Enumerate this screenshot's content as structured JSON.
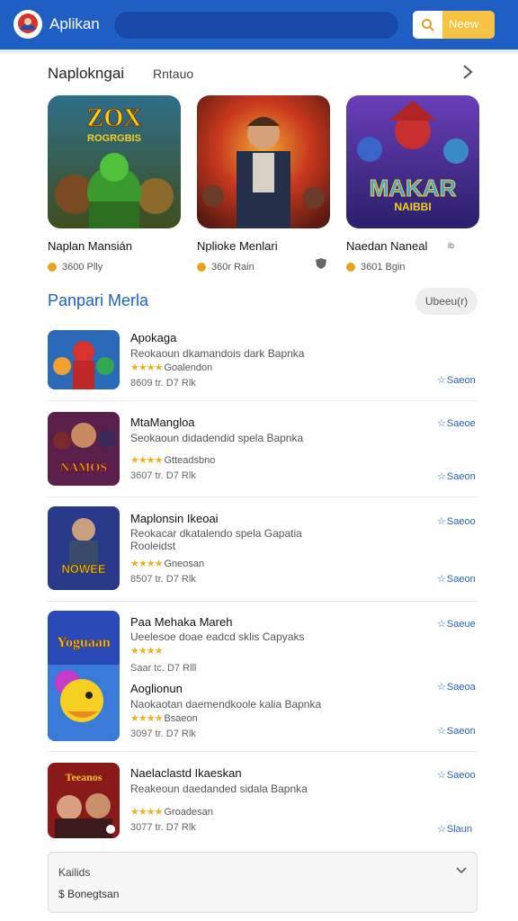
{
  "header": {
    "title": "Aplikan",
    "new_label": "Neew"
  },
  "featured": {
    "title": "Naplokngai",
    "subtitle": "Rntauo",
    "cards": [
      {
        "name": "Naplan Mansián",
        "meta": "3600 Plly",
        "art_text_1": "ZOX",
        "art_text_2": "ROGRGBIS"
      },
      {
        "name": "Nplioke Menlari",
        "meta": "360r Rain"
      },
      {
        "name": "Naedan Naneal",
        "meta": "3601 Bgin",
        "art_text_1": "MAKAR",
        "art_text_2": "NAIBBI"
      }
    ],
    "extra_mark": "ib"
  },
  "popular": {
    "title": "Panpari Merla",
    "button_label": "Ubeeu(r)",
    "items": [
      {
        "title": "Apokaga",
        "desc": "Reokaoun dkamandois dark Bapnka",
        "rating_text": "Goalendon",
        "meta": "8609 tr. D7  Rlk",
        "action_bottom": "Saeon"
      },
      {
        "title": "MtaMangloa",
        "desc": "Seokaoun didadendid spela Bapnka",
        "rating_text": "Gtteadsbno",
        "meta": "3607 tr. D7  Rlk",
        "action_top": "Saeoe",
        "action_bottom": "Saeon",
        "art_text": "NAMOS"
      },
      {
        "title": "Maplonsin Ikeoai",
        "desc": "Reokacar dkatalendo spela Gapatia",
        "desc2": "Rooleidst",
        "rating_text": "Gneosan",
        "meta": "8507 tr. D7  Rlk",
        "action_top": "Saeoo",
        "action_bottom": "Saeon",
        "art_text": "NOWEE"
      },
      {
        "title": "Paa Mehaka Mareh",
        "desc": "Ueelesoe doae eadcd sklis Capyaks",
        "meta": "Saar tc. D7  Rlll",
        "action_top": "Saeue",
        "art_text": "Yoguaan"
      },
      {
        "title": "Aoglionun",
        "desc": "Naokaotan daemendkoole kalia Bapnka",
        "rating_text": "Bsaeon",
        "meta": "3097 tr. D7  Rlk",
        "action_top": "Saeoa",
        "action_bottom": "Saeon"
      },
      {
        "title": "Naelaclastd Ikaeskan",
        "desc": "Reakeoun daedanded sidala Bapnka",
        "rating_text": "Groadesan",
        "meta": "3077 tr. D7  Rlk",
        "action_top": "Saeoo",
        "action_bottom": "Slaun",
        "art_text": "Teeanos"
      }
    ]
  },
  "bottom_card": {
    "title": "Kailids",
    "subtitle": "$ Bonegtsan"
  }
}
